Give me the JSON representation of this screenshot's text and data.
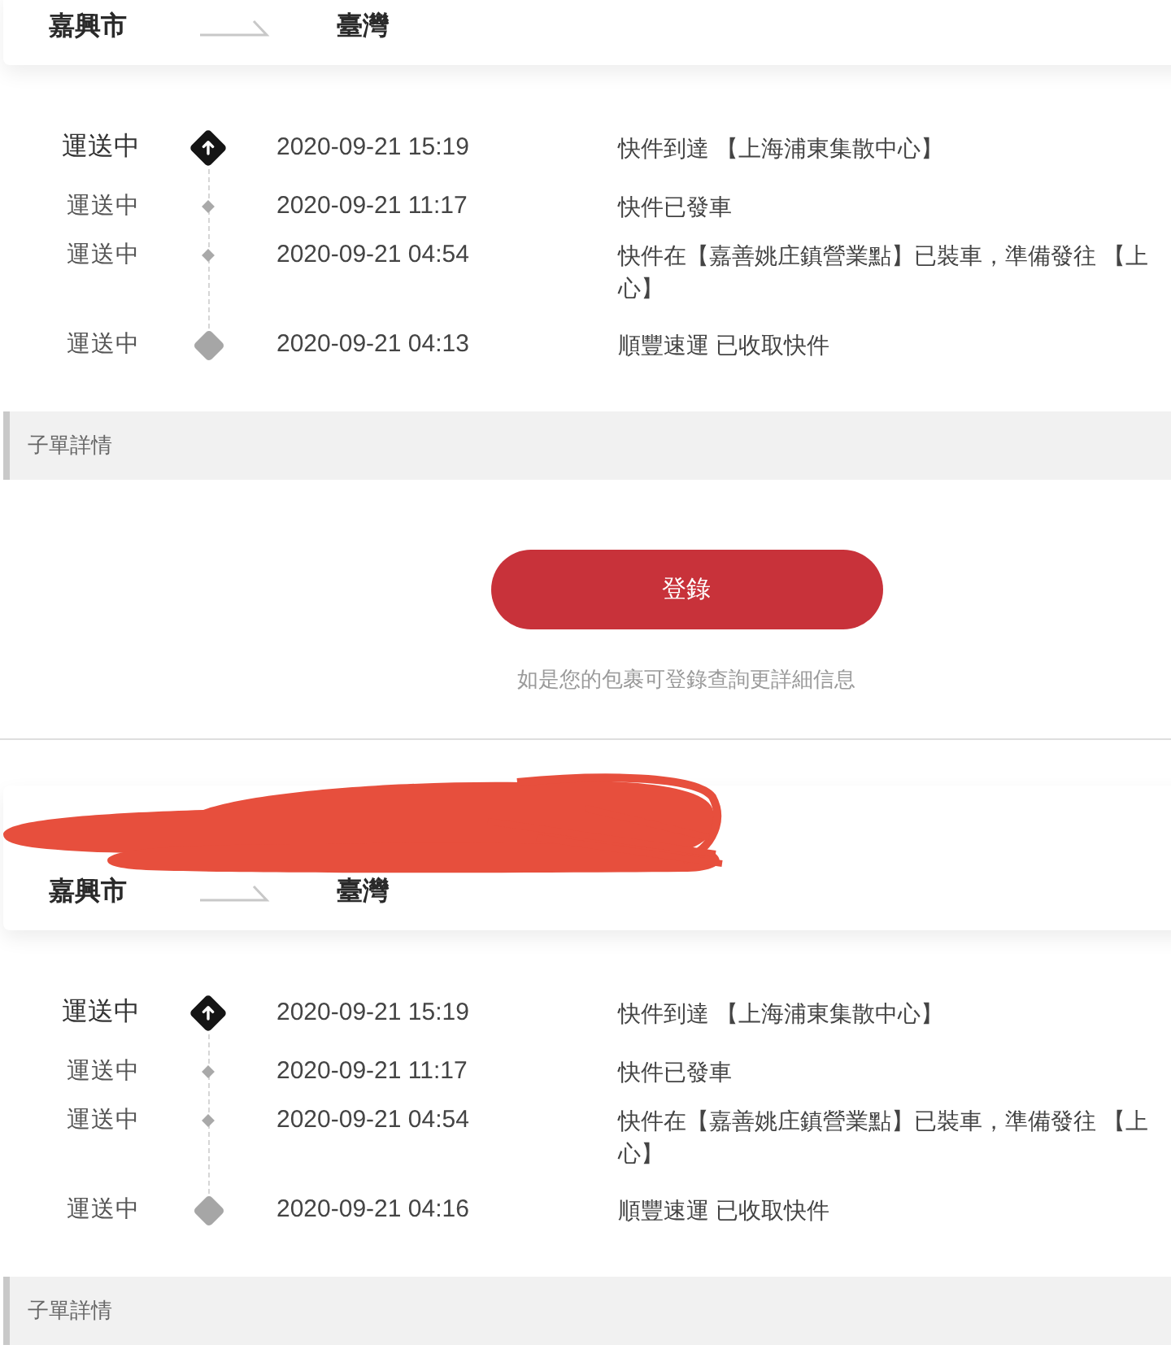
{
  "packages": [
    {
      "redacted": false,
      "route": {
        "origin": "嘉興市",
        "destination": "臺灣"
      },
      "events": [
        {
          "kind": "latest",
          "status": "運送中",
          "time": "2020-09-21 15:19",
          "description": [
            "快件到達 【上海浦東集散中心】"
          ]
        },
        {
          "kind": "transit",
          "status": "運送中",
          "time": "2020-09-21 11:17",
          "description": [
            "快件已發車"
          ]
        },
        {
          "kind": "transit",
          "status": "運送中",
          "time": "2020-09-21 04:54",
          "description": [
            "快件在【嘉善姚庄鎮營業點】已裝車，準備發往 【上",
            "心】"
          ]
        },
        {
          "kind": "origin",
          "status": "運送中",
          "time": "2020-09-21 04:13",
          "description": [
            "順豐速運 已收取快件"
          ]
        }
      ],
      "section": "子單詳情",
      "login": {
        "button": "登錄",
        "hint": "如是您的包裹可登錄查詢更詳細信息"
      }
    },
    {
      "redacted": true,
      "route": {
        "origin": "嘉興市",
        "destination": "臺灣"
      },
      "events": [
        {
          "kind": "latest",
          "status": "運送中",
          "time": "2020-09-21 15:19",
          "description": [
            "快件到達 【上海浦東集散中心】"
          ]
        },
        {
          "kind": "transit",
          "status": "運送中",
          "time": "2020-09-21 11:17",
          "description": [
            "快件已發車"
          ]
        },
        {
          "kind": "transit",
          "status": "運送中",
          "time": "2020-09-21 04:54",
          "description": [
            "快件在【嘉善姚庄鎮營業點】已裝車，準備發往 【上",
            "心】"
          ]
        },
        {
          "kind": "origin",
          "status": "運送中",
          "time": "2020-09-21 04:16",
          "description": [
            "順豐速運 已收取快件"
          ]
        }
      ],
      "section": "子單詳情"
    }
  ]
}
